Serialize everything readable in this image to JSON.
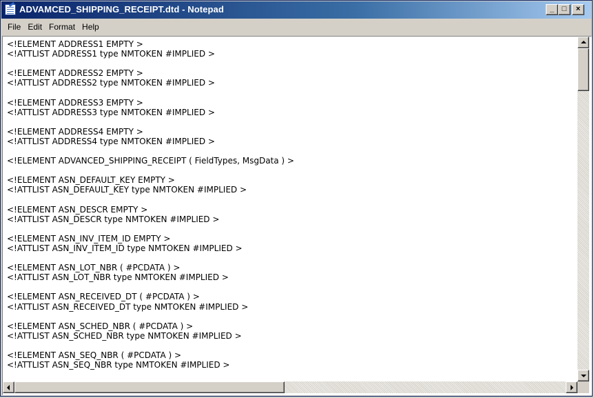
{
  "window": {
    "title": "ADVAMCED_SHIPPING_RECEIPT.dtd - Notepad",
    "app_icon": "notepad-icon",
    "caption_buttons": {
      "minimize": "_",
      "maximize": "□",
      "close": "×"
    }
  },
  "menu": {
    "items": [
      "File",
      "Edit",
      "Format",
      "Help"
    ]
  },
  "editor": {
    "content": "<!ELEMENT ADDRESS1 EMPTY >\n<!ATTLIST ADDRESS1 type NMTOKEN #IMPLIED >\n\n<!ELEMENT ADDRESS2 EMPTY >\n<!ATTLIST ADDRESS2 type NMTOKEN #IMPLIED >\n\n<!ELEMENT ADDRESS3 EMPTY >\n<!ATTLIST ADDRESS3 type NMTOKEN #IMPLIED >\n\n<!ELEMENT ADDRESS4 EMPTY >\n<!ATTLIST ADDRESS4 type NMTOKEN #IMPLIED >\n\n<!ELEMENT ADVANCED_SHIPPING_RECEIPT ( FieldTypes, MsgData ) >\n\n<!ELEMENT ASN_DEFAULT_KEY EMPTY >\n<!ATTLIST ASN_DEFAULT_KEY type NMTOKEN #IMPLIED >\n\n<!ELEMENT ASN_DESCR EMPTY >\n<!ATTLIST ASN_DESCR type NMTOKEN #IMPLIED >\n\n<!ELEMENT ASN_INV_ITEM_ID EMPTY >\n<!ATTLIST ASN_INV_ITEM_ID type NMTOKEN #IMPLIED >\n\n<!ELEMENT ASN_LOT_NBR ( #PCDATA ) >\n<!ATTLIST ASN_LOT_NBR type NMTOKEN #IMPLIED >\n\n<!ELEMENT ASN_RECEIVED_DT ( #PCDATA ) >\n<!ATTLIST ASN_RECEIVED_DT type NMTOKEN #IMPLIED >\n\n<!ELEMENT ASN_SCHED_NBR ( #PCDATA ) >\n<!ATTLIST ASN_SCHED_NBR type NMTOKEN #IMPLIED >\n\n<!ELEMENT ASN_SEQ_NBR ( #PCDATA ) >\n<!ATTLIST ASN_SEQ_NBR type NMTOKEN #IMPLIED >"
  },
  "scrollbars": {
    "vertical_position": 0,
    "horizontal_position": 0
  },
  "colors": {
    "titlebar_start": "#0a246a",
    "titlebar_end": "#a6caf0",
    "chrome": "#d4d0c8",
    "text": "#000000",
    "editor_bg": "#ffffff"
  }
}
